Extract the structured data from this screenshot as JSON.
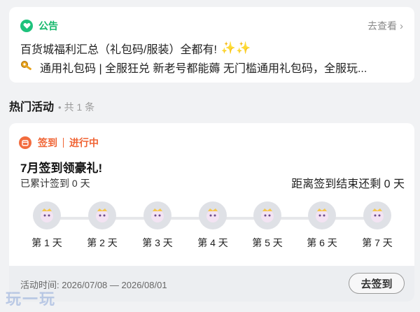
{
  "notice": {
    "tag": "公告",
    "more_label": "去查看",
    "line1": "百货城福利汇总（礼包码/服装）全都有!",
    "line2": "通用礼包码 | 全服狂兑 新老号都能薅 无门槛通用礼包码，全服玩..."
  },
  "section": {
    "title": "热门活动",
    "count": "共 1 条"
  },
  "activity": {
    "type": "签到",
    "status": "进行中",
    "title": "7月签到领豪礼!",
    "accumulated": "已累计签到 0 天",
    "remaining": "距离签到结束还剩 0 天",
    "days": [
      {
        "label": "第 1 天"
      },
      {
        "label": "第 2 天"
      },
      {
        "label": "第 3 天"
      },
      {
        "label": "第 4 天"
      },
      {
        "label": "第 5 天"
      },
      {
        "label": "第 6 天"
      },
      {
        "label": "第 7 天"
      }
    ],
    "time": "活动时间: 2026/07/08 — 2026/08/01",
    "button": "去签到"
  },
  "watermark": "玩一玩",
  "colors": {
    "notice_green": "#16b86c",
    "activity_orange": "#f06434",
    "background": "#f1f2f4"
  }
}
